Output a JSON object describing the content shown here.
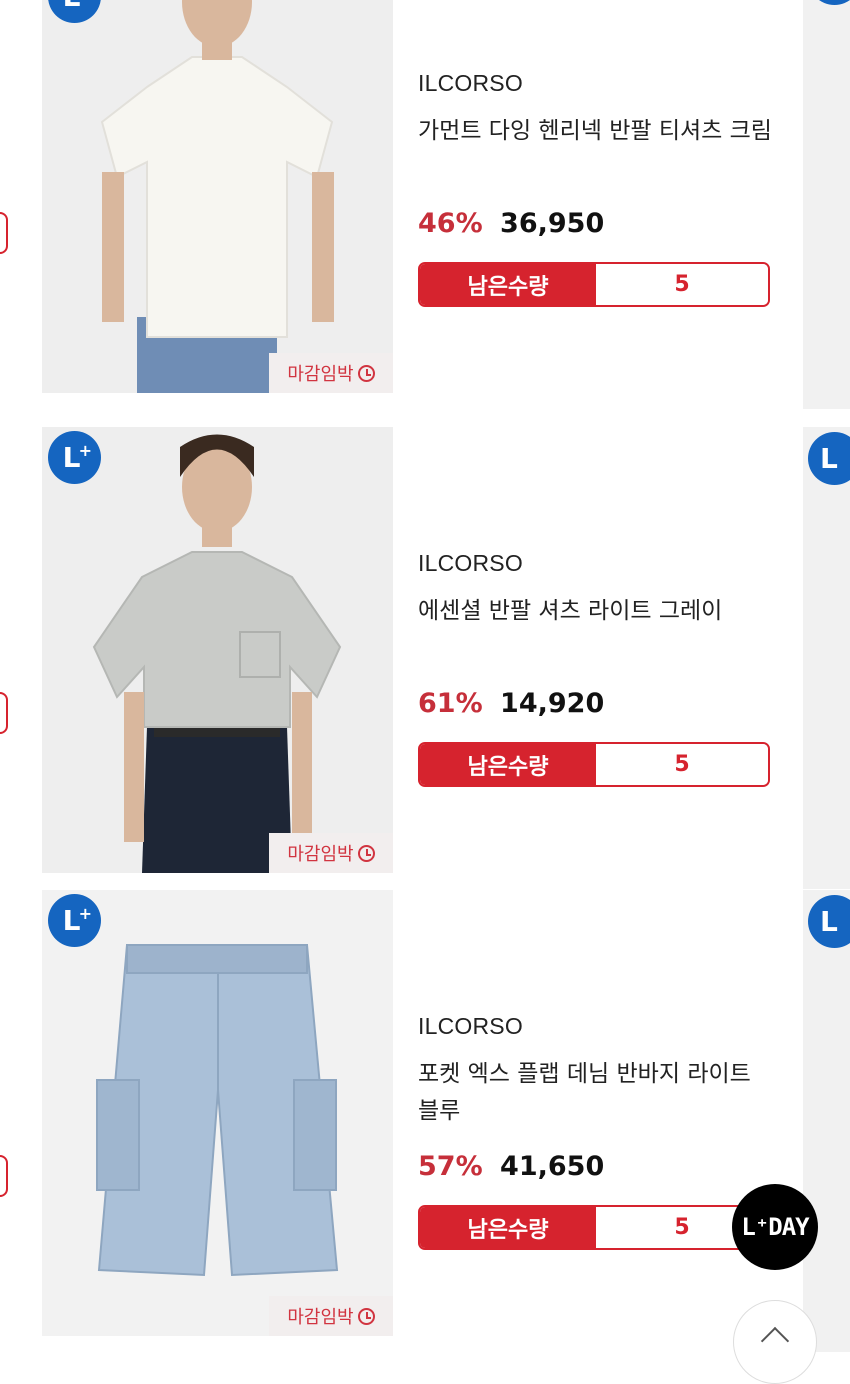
{
  "products": [
    {
      "brand": "ILCORSO",
      "title": "가먼트 다잉 헨리넥 반팔 티셔츠 크림",
      "discount": "46%",
      "price": "36,950",
      "stock_label": "남은수량",
      "stock_qty": "5",
      "deadline_label": "마감임박",
      "badge": "L",
      "item_color": "#f4f3ee",
      "bottom_color": "#6f8db5"
    },
    {
      "brand": "ILCORSO",
      "title": "에센셜 반팔 셔츠 라이트 그레이",
      "discount": "61%",
      "price": "14,920",
      "stock_label": "남은수량",
      "stock_qty": "5",
      "deadline_label": "마감임박",
      "badge": "L",
      "item_color": "#c9cbc8",
      "bottom_color": "#1e2636"
    },
    {
      "brand": "ILCORSO",
      "title": "포켓 엑스 플랩 데님 반바지 라이트 블루",
      "discount": "57%",
      "price": "41,650",
      "stock_label": "남은수량",
      "stock_qty": "5",
      "deadline_label": "마감임박",
      "badge": "L",
      "item_color": "#aac0d8",
      "bottom_color": "#aac0d8"
    }
  ],
  "floating": {
    "lday_label": "L⁺DAY"
  },
  "icons": {
    "badge_icon": "l-plus-icon",
    "deadline_icon": "clock-icon",
    "scroll_top_icon": "chevron-up-icon"
  }
}
